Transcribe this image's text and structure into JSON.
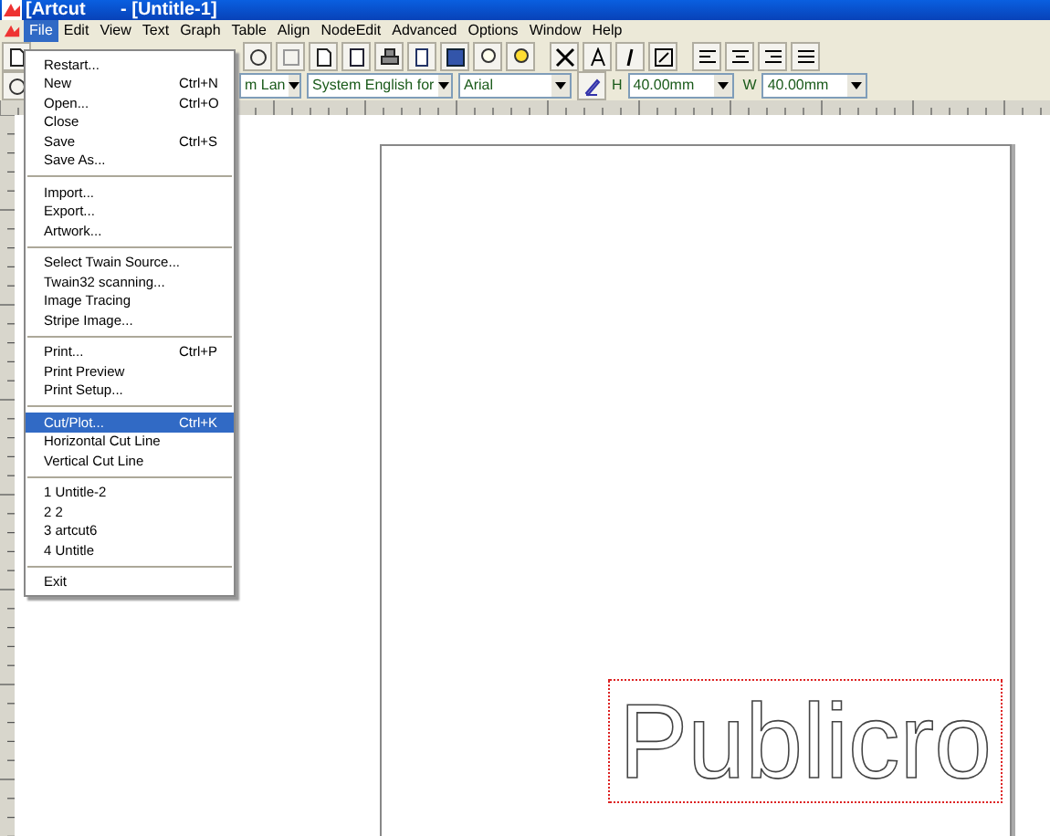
{
  "window": {
    "app_title": "[Artcut",
    "document_title": "- [Untitle-1]"
  },
  "menu_bar": [
    {
      "label": "File",
      "selected": true
    },
    {
      "label": "Edit",
      "selected": false
    },
    {
      "label": "View",
      "selected": false
    },
    {
      "label": "Text",
      "selected": false
    },
    {
      "label": "Graph",
      "selected": false
    },
    {
      "label": "Table",
      "selected": false
    },
    {
      "label": "Align",
      "selected": false
    },
    {
      "label": "NodeEdit",
      "selected": false
    },
    {
      "label": "Advanced",
      "selected": false
    },
    {
      "label": "Options",
      "selected": false
    },
    {
      "label": "Window",
      "selected": false
    },
    {
      "label": "Help",
      "selected": false
    }
  ],
  "file_menu": [
    [
      {
        "label": "Restart...",
        "selected": false
      },
      {
        "label": "New",
        "shortcut": "Ctrl+N",
        "selected": false
      },
      {
        "label": "Open...",
        "shortcut": "Ctrl+O",
        "selected": false
      },
      {
        "label": "Close",
        "selected": false
      },
      {
        "label": "Save",
        "shortcut": "Ctrl+S",
        "selected": false
      },
      {
        "label": "Save As...",
        "selected": false
      }
    ],
    [
      {
        "label": "Import...",
        "selected": false
      },
      {
        "label": "Export...",
        "selected": false
      },
      {
        "label": "Artwork...",
        "selected": false
      }
    ],
    [
      {
        "label": "Select Twain Source...",
        "selected": false
      },
      {
        "label": "Twain32 scanning...",
        "selected": false
      },
      {
        "label": "Image Tracing",
        "selected": false
      },
      {
        "label": "Stripe Image...",
        "selected": false
      }
    ],
    [
      {
        "label": "Print...",
        "shortcut": "Ctrl+P",
        "selected": false
      },
      {
        "label": "Print Preview",
        "selected": false
      },
      {
        "label": "Print Setup...",
        "selected": false
      }
    ],
    [
      {
        "label": "Cut/Plot...",
        "shortcut": "Ctrl+K",
        "selected": true
      },
      {
        "label": "Horizontal Cut Line",
        "selected": false
      },
      {
        "label": "Vertical Cut Line",
        "selected": false
      }
    ],
    [
      {
        "label": "1 Untitle-2",
        "selected": false
      },
      {
        "label": "2 2",
        "selected": false
      },
      {
        "label": "3 artcut6",
        "selected": false
      },
      {
        "label": "4 Untitle",
        "selected": false
      }
    ],
    [
      {
        "label": "Exit",
        "selected": false
      }
    ]
  ],
  "format_bar": {
    "font_language": "m Lan",
    "input_language": "System English for",
    "font": "Arial",
    "height_label": "H",
    "height": "40.00mm",
    "width_label": "W",
    "width": "40.00mm"
  },
  "canvas": {
    "text": "Publicro",
    "selected": true
  }
}
